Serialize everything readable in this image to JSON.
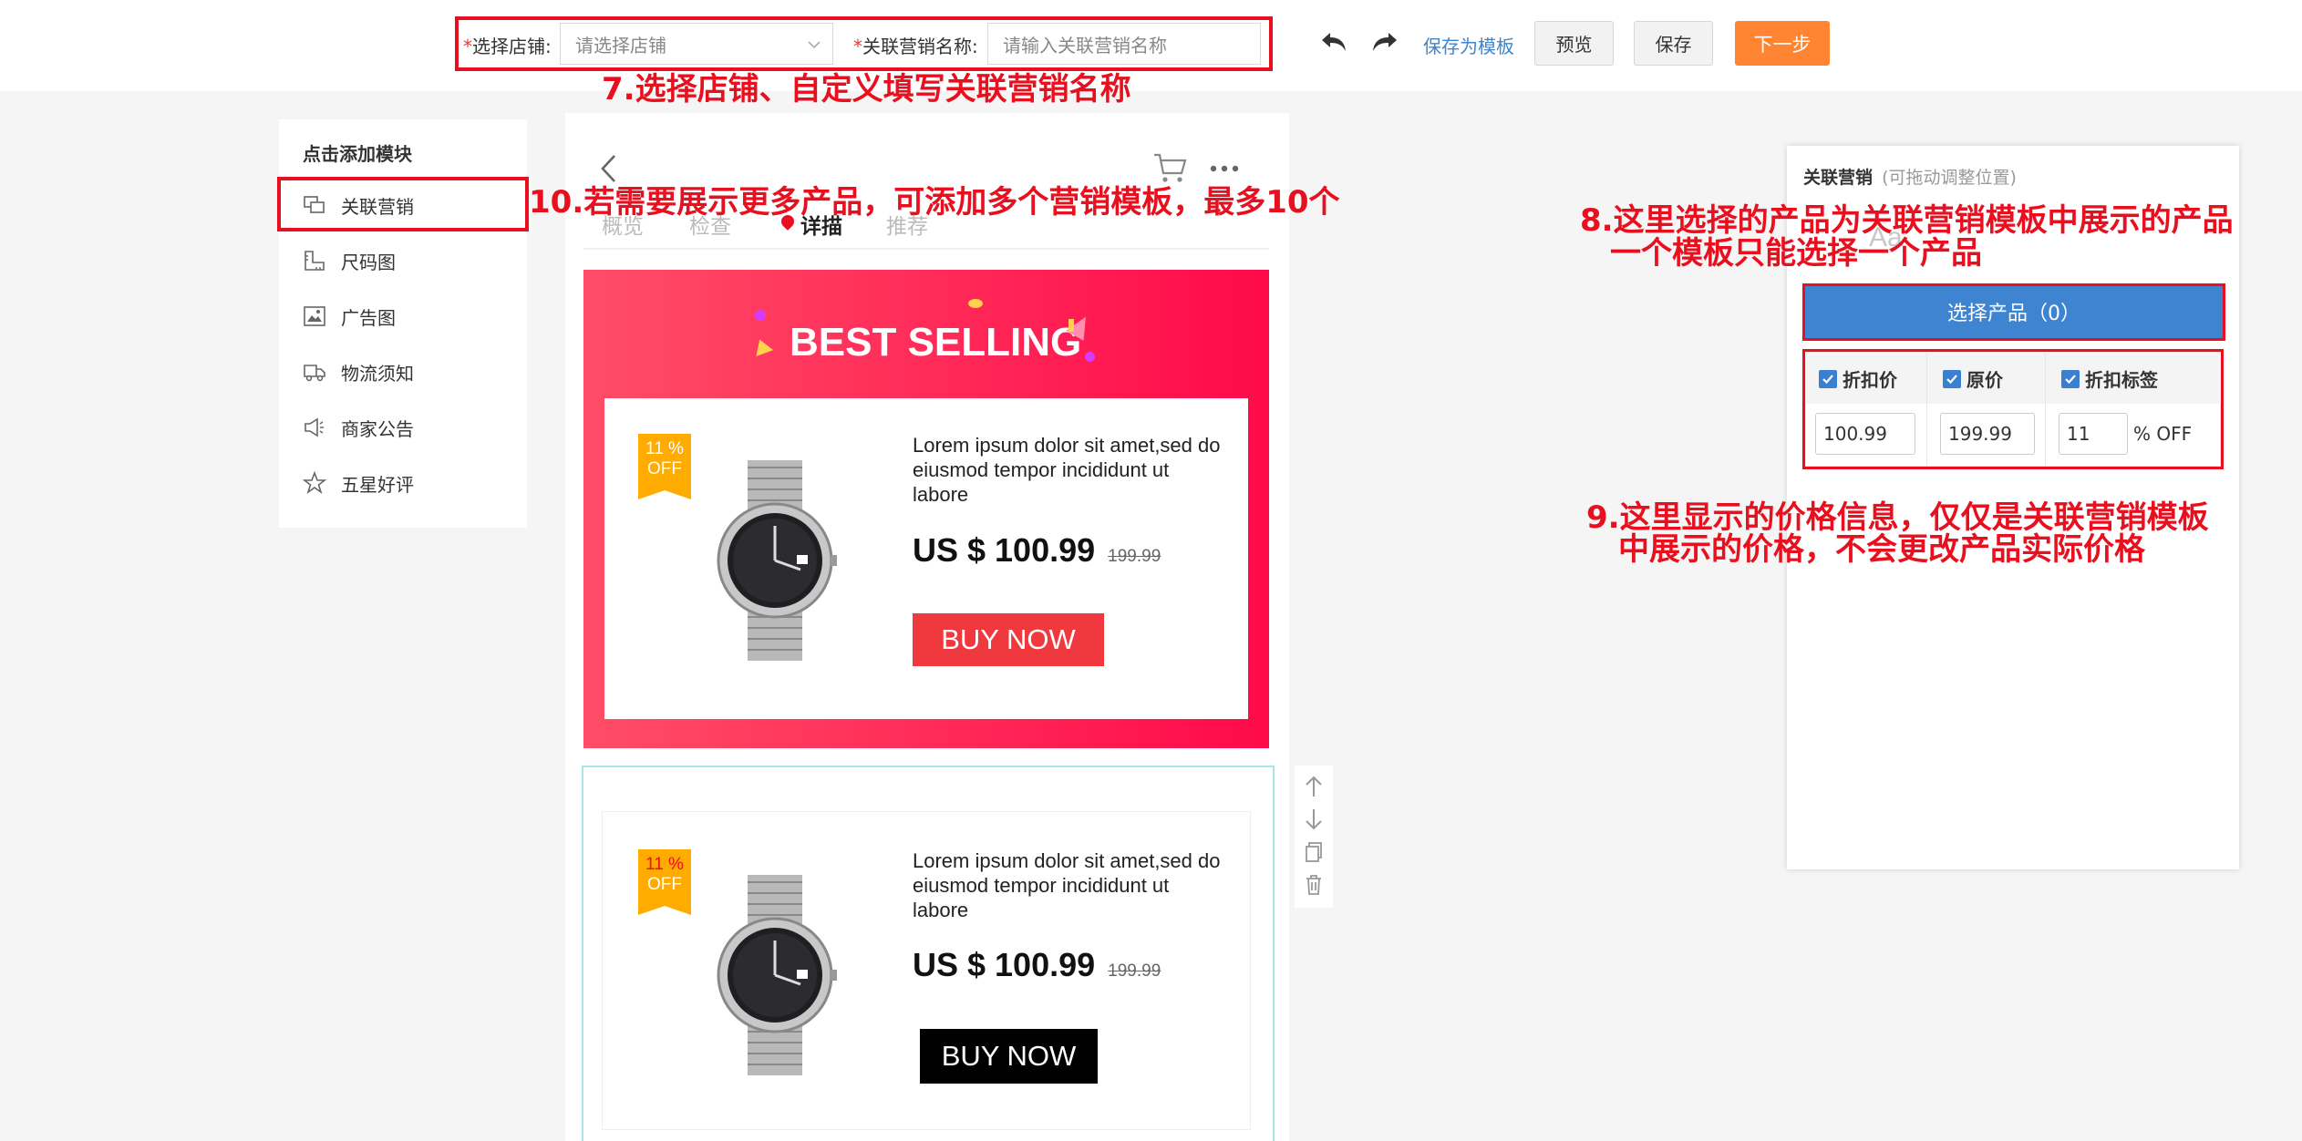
{
  "header": {
    "store_label": "选择店铺:",
    "store_placeholder": "请选择店铺",
    "marketing_name_label": "关联营销名称:",
    "marketing_name_placeholder": "请输入关联营销名称",
    "required_mark": "*",
    "save_template": "保存为模板",
    "preview": "预览",
    "save": "保存",
    "next": "下一步"
  },
  "annotations": {
    "a7": "7.选择店铺、自定义填写关联营销名称",
    "a10": "10.若需要展示更多产品，可添加多个营销模板，最多10个",
    "a8_line1": "8.这里选择的产品为关联营销模板中展示的产品",
    "a8_line2": "一个模板只能选择一个产品",
    "a9_line1": "9.这里显示的价格信息，仅仅是关联营销模板",
    "a9_line2": "中展示的价格，不会更改产品实际价格"
  },
  "left_panel": {
    "title": "点击添加模块",
    "items": [
      {
        "label": "关联营销",
        "icon": "related-marketing-icon"
      },
      {
        "label": "尺码图",
        "icon": "ruler-icon"
      },
      {
        "label": "广告图",
        "icon": "image-icon"
      },
      {
        "label": "物流须知",
        "icon": "truck-icon"
      },
      {
        "label": "商家公告",
        "icon": "megaphone-icon"
      },
      {
        "label": "五星好评",
        "icon": "star-icon"
      }
    ]
  },
  "phone": {
    "tabs": [
      "概览",
      "检查",
      "详描",
      "推荐"
    ],
    "promo_title": "BEST SELLING",
    "products": [
      {
        "badge_pct": "11 %",
        "badge_off": "OFF",
        "description": "Lorem ipsum dolor sit amet,sed do eiusmod tempor incididunt ut labore",
        "price": "US $ 100.99",
        "original_price": "199.99",
        "buy": "BUY NOW"
      },
      {
        "badge_pct": "11 %",
        "badge_off": "OFF",
        "description": "Lorem ipsum dolor sit amet,sed do eiusmod tempor incididunt ut labore",
        "price": "US $ 100.99",
        "original_price": "199.99",
        "buy": "BUY NOW"
      }
    ]
  },
  "right_panel": {
    "title": "关联营销",
    "hint": "(可拖动调整位置)",
    "select_product": "选择产品（0）",
    "checkbox_discount": "折扣价",
    "checkbox_original": "原价",
    "checkbox_tag": "折扣标签",
    "discount_value": "100.99",
    "original_value": "199.99",
    "tag_value": "11",
    "tag_suffix": "% OFF",
    "faint_text": "Aa"
  },
  "colors": {
    "annotation_red": "#e8101e",
    "accent_orange": "#ff8533",
    "primary_blue": "#3f84d0",
    "promo_pink": "#ff2a55",
    "buy_red": "#f0393e",
    "badge_orange": "#ffab00"
  }
}
